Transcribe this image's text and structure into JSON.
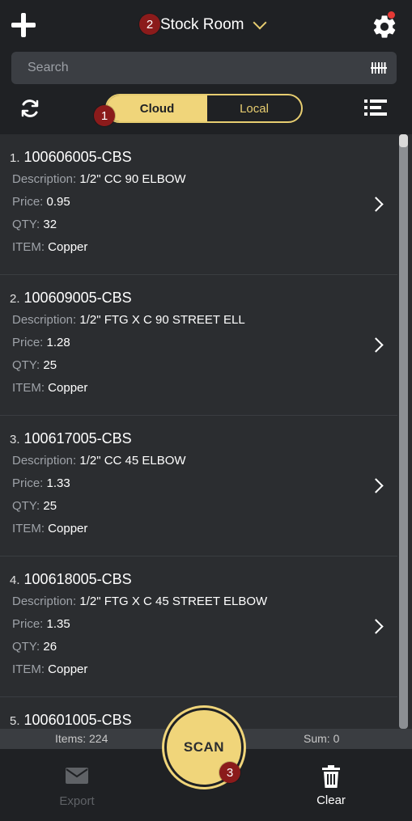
{
  "header": {
    "location": "Stock Room",
    "search_placeholder": "Search",
    "toggle": {
      "cloud": "Cloud",
      "local": "Local",
      "selected": "Cloud"
    }
  },
  "markers": [
    "1",
    "2",
    "3"
  ],
  "items": [
    {
      "num": "1.",
      "code": "100606005-CBS",
      "description": "1/2\" CC 90 ELBOW",
      "price": "0.95",
      "qty": "32",
      "item": "Copper"
    },
    {
      "num": "2.",
      "code": "100609005-CBS",
      "description": "1/2\" FTG X C 90 STREET ELL",
      "price": "1.28",
      "qty": "25",
      "item": "Copper"
    },
    {
      "num": "3.",
      "code": "100617005-CBS",
      "description": "1/2\" CC 45 ELBOW",
      "price": "1.33",
      "qty": "25",
      "item": "Copper"
    },
    {
      "num": "4.",
      "code": "100618005-CBS",
      "description": "1/2\" FTG X C 45 STREET ELBOW",
      "price": "1.35",
      "qty": "26",
      "item": "Copper"
    },
    {
      "num": "5.",
      "code": "100601005-CBS"
    }
  ],
  "labels": {
    "description": "Description:",
    "price": "Price:",
    "qty": "QTY:",
    "item": "ITEM:"
  },
  "summary": {
    "items": "Items: 224",
    "sum": "Sum: 0"
  },
  "bottom": {
    "export": "Export",
    "scan": "SCAN",
    "clear": "Clear"
  },
  "colors": {
    "accent": "#f0d57a",
    "marker": "#8b1b1b",
    "notification": "#e53935"
  },
  "icons": [
    "add-icon",
    "chevron-down-icon",
    "gear-icon",
    "barcode-icon",
    "refresh-icon",
    "list-icon",
    "chevron-right-icon",
    "mail-icon",
    "trash-icon"
  ]
}
